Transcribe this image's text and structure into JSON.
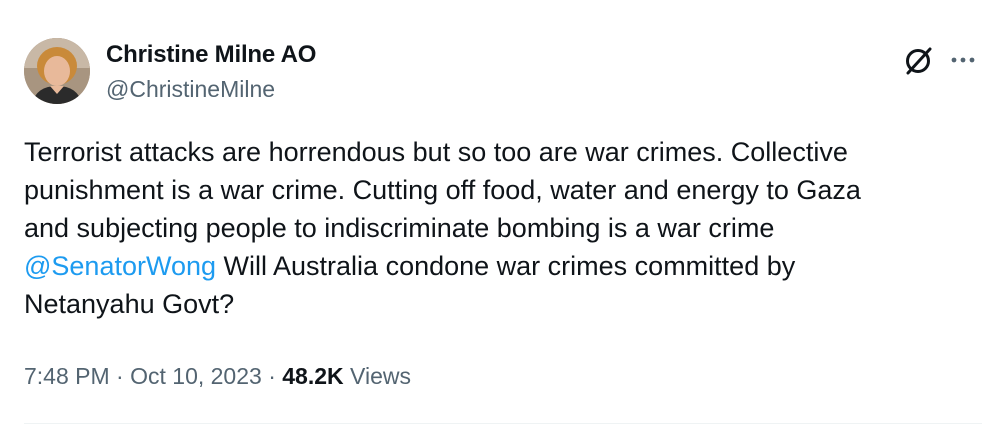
{
  "author": {
    "name": "Christine Milne AO",
    "handle": "@ChristineMilne"
  },
  "tweet": {
    "line1": "Terrorist attacks are horrendous but so too are war crimes. Collective",
    "line2": "punishment is a war crime. Cutting off food, water and energy to Gaza",
    "line3": "and subjecting people to indiscriminate bombing is a war crime",
    "mention": "@SenatorWong",
    "line4_rest": " Will Australia condone war crimes committed by",
    "line5": "Netanyahu Govt?"
  },
  "meta": {
    "time": "7:48 PM",
    "separator": " · ",
    "date": "Oct 10, 2023",
    "views_count": "48.2K",
    "views_label": " Views"
  },
  "icons": {
    "grok": "grok-icon",
    "more": "more-icon"
  },
  "colors": {
    "link": "#1d9bf0",
    "secondary_text": "#536471",
    "primary_text": "#0f1419",
    "divider": "#eff3f4"
  }
}
